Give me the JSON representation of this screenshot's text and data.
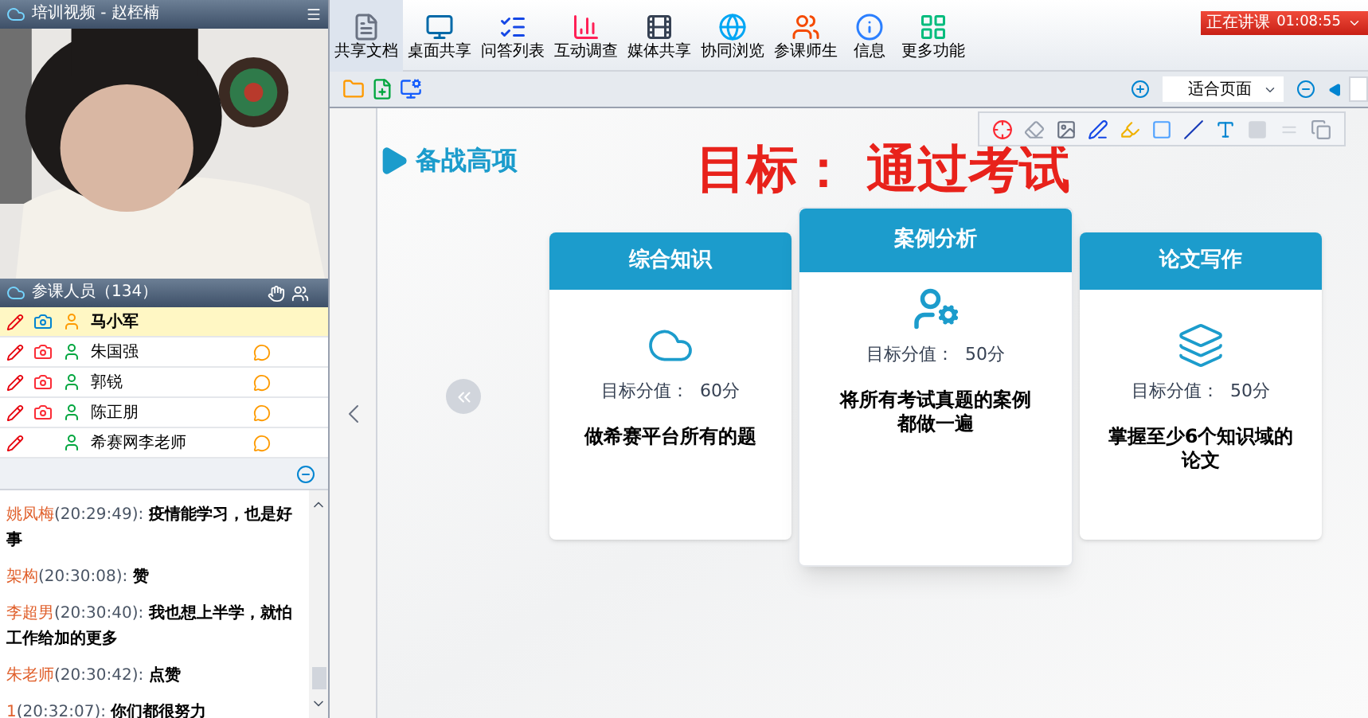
{
  "video": {
    "title": "培训视频 - 赵桎楠"
  },
  "participants": {
    "title": "参课人员（134）",
    "rows": [
      {
        "name": "马小军",
        "selected": true,
        "kind": "host"
      },
      {
        "name": "朱国强",
        "selected": false,
        "kind": "student"
      },
      {
        "name": "郭锐",
        "selected": false,
        "kind": "student"
      },
      {
        "name": "陈正朋",
        "selected": false,
        "kind": "student"
      },
      {
        "name": "希赛网李老师",
        "selected": false,
        "kind": "guest"
      }
    ]
  },
  "chat": {
    "messages": [
      {
        "sender": "姚凤梅",
        "time": "(20:29:49):",
        "text": "疫情能学习，也是好事"
      },
      {
        "sender": "架构",
        "time": "(20:30:08):",
        "text": "赞"
      },
      {
        "sender": "李超男",
        "time": "(20:30:40):",
        "text": "我也想上半学，就怕工作给加的更多"
      },
      {
        "sender": "朱老师",
        "time": "(20:30:42):",
        "text": "点赞"
      },
      {
        "sender": "1",
        "time": "(20:32:07):",
        "text": "你们都很努力"
      }
    ]
  },
  "toolbar": {
    "buttons": [
      {
        "label": "共享文档",
        "selected": true
      },
      {
        "label": "桌面共享",
        "selected": false
      },
      {
        "label": "问答列表",
        "selected": false
      },
      {
        "label": "互动调查",
        "selected": false
      },
      {
        "label": "媒体共享",
        "selected": false
      },
      {
        "label": "协同浏览",
        "selected": false
      },
      {
        "label": "参课师生",
        "selected": false
      },
      {
        "label": "信息",
        "selected": false
      },
      {
        "label": "更多功能",
        "selected": false
      }
    ],
    "status": {
      "label": "正在讲课",
      "time": "01:08:55"
    }
  },
  "zoom": {
    "value": "适合页面"
  },
  "slide": {
    "section": "备战高项",
    "heading": "目标： 通过考试",
    "cards": [
      {
        "title": "综合知识",
        "kind": "cloud",
        "score": "目标分值：  60分",
        "desc": "做希赛平台所有的题",
        "featured": false
      },
      {
        "title": "案例分析",
        "kind": "person",
        "score": "目标分值：  50分",
        "desc": "将所有考试真题的案例都做一遍",
        "featured": true
      },
      {
        "title": "论文写作",
        "kind": "layers",
        "score": "目标分值：  50分",
        "desc": "掌握至少6个知识域的论文",
        "featured": false
      }
    ]
  }
}
